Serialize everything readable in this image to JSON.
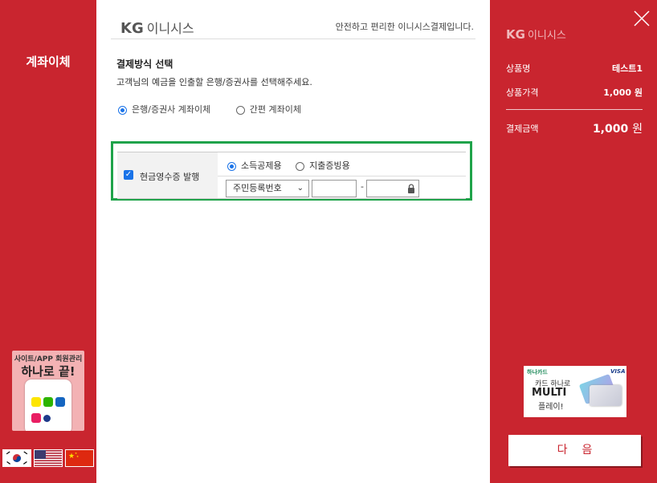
{
  "left": {
    "title": "계좌이체",
    "ad": {
      "line1": "사이트/APP 회원관리",
      "line2": "하나로 끝!"
    }
  },
  "flags": [
    "korea-flag",
    "usa-flag",
    "china-flag"
  ],
  "center": {
    "logo_kg": "KG",
    "logo_text": "이니시스",
    "tagline": "안전하고 편리한 이니시스결제입니다.",
    "section_title": "결제방식 선택",
    "section_desc": "고객님의 예금을 인출할 은행/증권사를 선택해주세요.",
    "payment_options": [
      {
        "label": "은행/증권사 계좌이체",
        "selected": true
      },
      {
        "label": "간편 계좌이체",
        "selected": false
      }
    ],
    "receipt": {
      "label": "현금영수증 발행",
      "checked": true,
      "type_options": [
        {
          "label": "소득공제용",
          "selected": true
        },
        {
          "label": "지출증빙용",
          "selected": false
        }
      ],
      "id_type_selected": "주민등록번호",
      "separator": "-"
    }
  },
  "right": {
    "logo_kg": "KG",
    "logo_text": "이니시스",
    "product_name_label": "상품명",
    "product_name_value": "테스트1",
    "product_price_label": "상품가격",
    "product_price_value": "1,000 원",
    "total_label": "결제금액",
    "total_value": "1,000",
    "total_unit": "원",
    "ad": {
      "brand": "하나카드",
      "line1": "카드 하나로",
      "line2": "MULTI",
      "line3": "플레이!",
      "visa": "VISA"
    },
    "next_button": "다음"
  },
  "colors": {
    "brand_red": "#c9252f",
    "highlight_green": "#1fa34a",
    "accent_blue": "#1a73e8"
  }
}
